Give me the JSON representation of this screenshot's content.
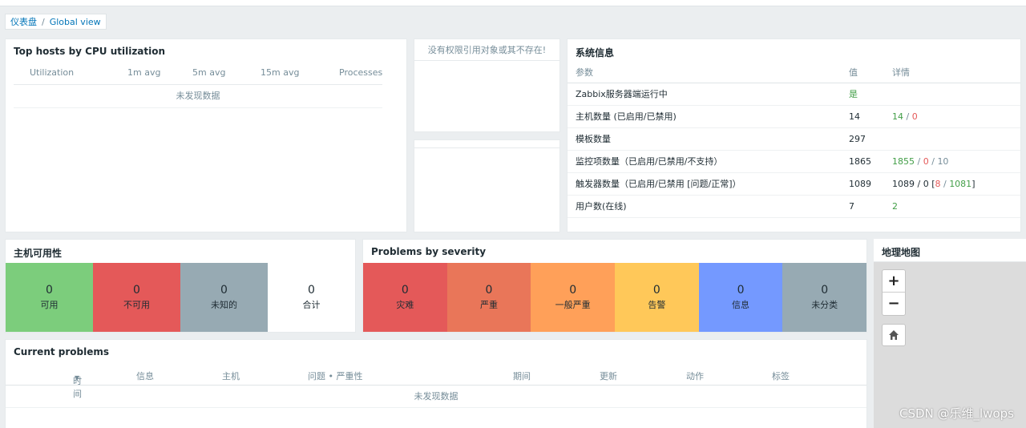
{
  "breadcrumb": {
    "home": "仪表盘",
    "separator": "/",
    "current": "Global view"
  },
  "top_hosts": {
    "title": "Top hosts by CPU utilization",
    "columns": [
      "Utilization",
      "1m avg",
      "5m avg",
      "15m avg",
      "Processes"
    ],
    "nodata": "未发现数据"
  },
  "noperm": {
    "text": "没有权限引用对象或其不存在!"
  },
  "sysinfo": {
    "title": "系统信息",
    "headers": {
      "param": "参数",
      "value": "值",
      "details": "详情"
    },
    "rows": [
      {
        "param": "Zabbix服务器端运行中",
        "value": "是"
      },
      {
        "param": "主机数量 (已启用/已禁用)",
        "value": "14",
        "d1": "14",
        "s1": "/",
        "d2": "0"
      },
      {
        "param": "模板数量",
        "value": "297"
      },
      {
        "param": "监控项数量（已启用/已禁用/不支持）",
        "value": "1865",
        "d1": "1855",
        "s1": "/",
        "d2": "0",
        "s2": "/",
        "d3": "10"
      },
      {
        "param": "触发器数量（已启用/已禁用 [问题/正常]）",
        "value": "1089",
        "d1": "1089 / 0 [",
        "d2": "8",
        "s2": " / ",
        "d3": "1081",
        "d4": "]"
      },
      {
        "param": "用户数(在线)",
        "value": "7",
        "d1": "2"
      }
    ]
  },
  "host_availability": {
    "title": "主机可用性",
    "cells": [
      {
        "count": "0",
        "label": "可用",
        "color": "#7ccd7c"
      },
      {
        "count": "0",
        "label": "不可用",
        "color": "#e45959"
      },
      {
        "count": "0",
        "label": "未知的",
        "color": "#97aab3"
      },
      {
        "count": "0",
        "label": "合计",
        "color": "#ffffff"
      }
    ]
  },
  "severity": {
    "title": "Problems by severity",
    "cells": [
      {
        "count": "0",
        "label": "灾难",
        "color": "#e45959"
      },
      {
        "count": "0",
        "label": "严重",
        "color": "#e97659"
      },
      {
        "count": "0",
        "label": "一般严重",
        "color": "#ffa059"
      },
      {
        "count": "0",
        "label": "告警",
        "color": "#ffc859"
      },
      {
        "count": "0",
        "label": "信息",
        "color": "#7499ff"
      },
      {
        "count": "0",
        "label": "未分类",
        "color": "#97aab3"
      }
    ]
  },
  "current_problems": {
    "title": "Current problems",
    "columns": [
      "时间",
      "信息",
      "主机",
      "问题 • 严重性",
      "期间",
      "更新",
      "动作",
      "标签"
    ],
    "sort_icon": "▼",
    "nodata": "未发现数据"
  },
  "map": {
    "title": "地理地图",
    "zoom_in": "+",
    "zoom_out": "−"
  },
  "watermark": "CSDN @乐维_lwops"
}
